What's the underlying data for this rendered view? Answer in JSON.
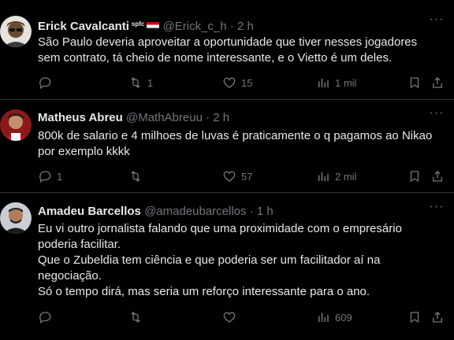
{
  "tweets": [
    {
      "name": "Erick Cavalcanti",
      "badge": "spfc",
      "handle": "@Erick_c_h",
      "sep": "·",
      "time": "2 h",
      "lines": [
        "São Paulo deveria aproveitar a oportunidade que tiver nesses jogadores",
        "sem contrato, tá cheio de nome interessante, e o Vietto é um deles."
      ],
      "replies": "",
      "retweets": "1",
      "likes": "15",
      "views": "1 mil"
    },
    {
      "name": "Matheus Abreu",
      "handle": "@MathAbreuu",
      "sep": "·",
      "time": "2 h",
      "lines": [
        "800k de salario e 4 milhoes de luvas é praticamente o q pagamos ao Nikao",
        "por exemplo kkkk"
      ],
      "replies": "1",
      "retweets": "",
      "likes": "57",
      "views": "2 mil"
    },
    {
      "name": "Amadeu Barcellos",
      "handle": "@amadeubarcellos",
      "sep": "·",
      "time": "1 h",
      "lines": [
        "Eu vi outro jornalista falando que uma proximidade com o empresário",
        "poderia facilitar.",
        "Que o Zubeldia tem ciência e que poderia ser um facilitador aí na",
        "negociação.",
        "Só o tempo dirá, mas seria um reforço interessante para o ano."
      ],
      "replies": "",
      "retweets": "",
      "likes": "",
      "views": "609"
    }
  ]
}
